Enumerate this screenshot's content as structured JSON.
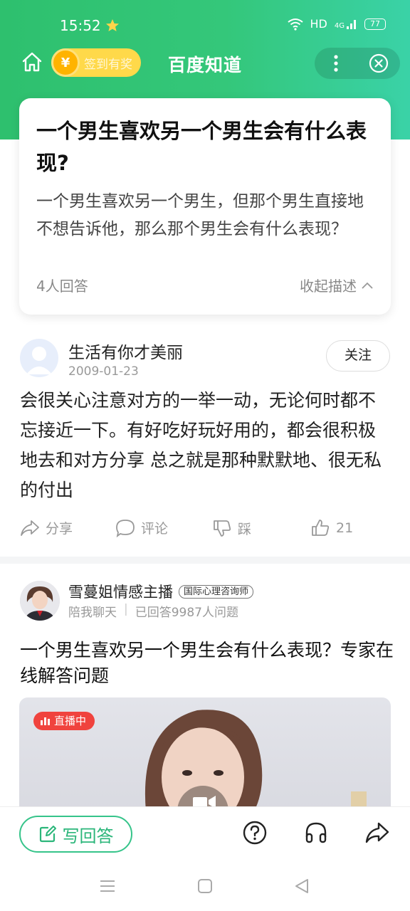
{
  "status_bar": {
    "time": "15:52",
    "network": "HD",
    "signal": "4G",
    "battery": "77"
  },
  "navbar": {
    "signin_label": "签到有奖",
    "coin_symbol": "¥",
    "title": "百度知道"
  },
  "question": {
    "title": "一个男生喜欢另一个男生会有什么表现?",
    "description": "一个男生喜欢另一个男生，但那个男生直接地不想告诉他，那么那个男生会有什么表现？",
    "answer_count": "4人回答",
    "collapse_label": "收起描述"
  },
  "answer": {
    "user_name": "生活有你才美丽",
    "date": "2009-01-23",
    "follow_label": "关注",
    "text": "会很关心注意对方的一举一动，无论何时都不忘接近一下。有好吃好玩好用的，都会很积极地去和对方分享 总之就是那种默默地、很无私的付出",
    "share_label": "分享",
    "comment_label": "评论",
    "dislike_label": "踩",
    "like_count": "21"
  },
  "expert": {
    "name": "雪蔓姐情感主播",
    "badge": "国际心理咨询师",
    "tag": "陪我聊天",
    "answered": "已回答9987人问题",
    "title": "一个男生喜欢另一个男生会有什么表现？专家在线解答问题",
    "live_label": "直播中"
  },
  "bottom_bar": {
    "write_label": "写回答"
  },
  "colors": {
    "brand_green": "#2ec06e",
    "accent_teal": "#3ad2a7",
    "live_red": "#f0433e"
  }
}
